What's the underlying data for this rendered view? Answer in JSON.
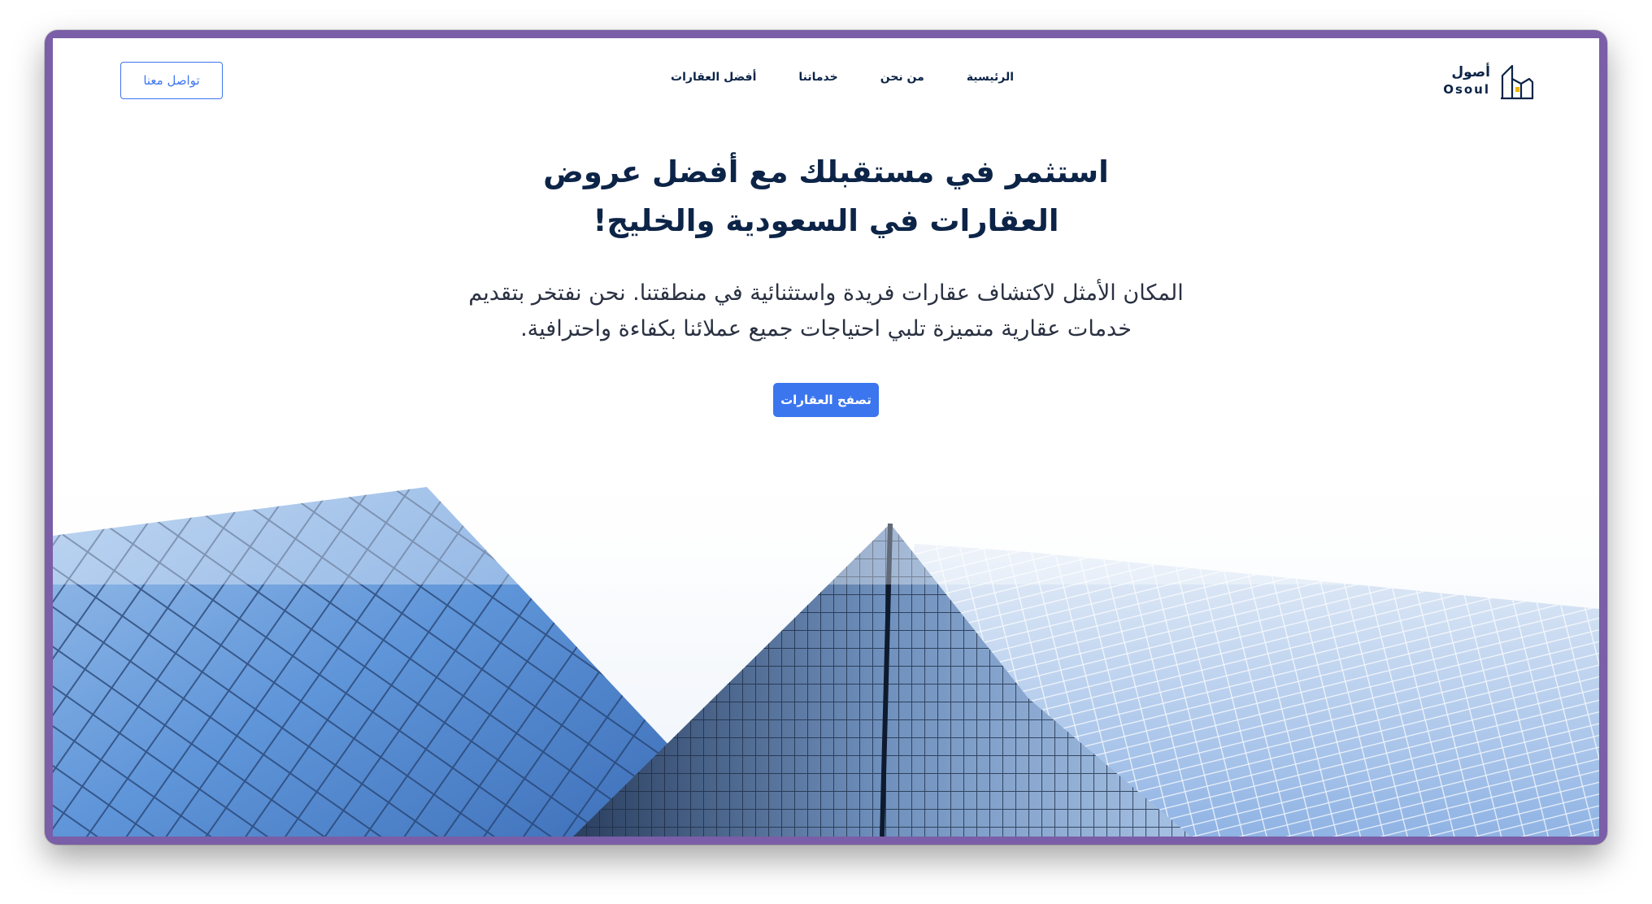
{
  "brand": {
    "name_ar": "أصول",
    "name_en": "Osoul"
  },
  "nav": {
    "items": [
      {
        "label": "الرئيسية"
      },
      {
        "label": "من نحن"
      },
      {
        "label": "خدماتنا"
      },
      {
        "label": "أفضل العقارات"
      }
    ]
  },
  "header": {
    "contact_label": "تواصل معنا"
  },
  "hero": {
    "title_line1": "استثمر في مستقبلك مع أفضل عروض",
    "title_line2": "العقارات في السعودية والخليج!",
    "subtitle_line1": "المكان الأمثل لاكتشاف عقارات فريدة واستثنائية في منطقتنا. نحن نفتخر بتقديم",
    "subtitle_line2": "خدمات عقارية متميزة تلبي احتياجات جميع عملائنا بكفاءة واحترافية.",
    "cta_label": "تصفح العقارات"
  },
  "colors": {
    "accent": "#3b76ef",
    "navy": "#0c2447",
    "frame": "#7a5ea7"
  }
}
